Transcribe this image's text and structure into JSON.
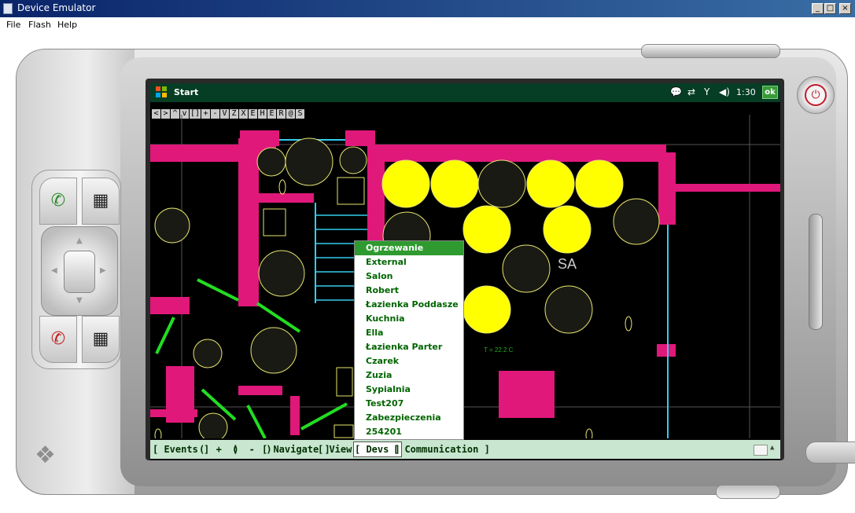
{
  "window": {
    "title": "Device Emulator",
    "buttons": {
      "minimize": "_",
      "maximize": "□",
      "close": "×"
    }
  },
  "menu": {
    "items": [
      "File",
      "Flash",
      "Help"
    ]
  },
  "device": {
    "taskbar": {
      "start_label": "Start",
      "time": "1:30",
      "ok_label": "ok",
      "status_icons": [
        "notification-bubble-icon",
        "connectivity-arrows-icon",
        "signal-off-icon",
        "speaker-icon"
      ]
    },
    "toolbar": {
      "buttons": [
        "<",
        ">",
        "^",
        "v",
        "[]",
        "+",
        "-",
        "V",
        "Z",
        "X",
        "E",
        "H",
        "E",
        "R",
        "@",
        "S"
      ]
    },
    "map": {
      "room_label": "SA",
      "temperature_label": "T = 22.2 C"
    },
    "dropdown": {
      "items": [
        "Ogrzewanie",
        "External",
        "Salon",
        "Robert",
        "Łazienka Poddasze",
        "Kuchnia",
        "Ella",
        "Łazienka Parter",
        "Czarek",
        "Zuzia",
        "Sypialnia",
        "Test207",
        "Zabezpieczenia",
        "254201"
      ],
      "selected": "Ogrzewanie"
    },
    "bottom_menu": {
      "events": "[ Events ]",
      "paren_open_plus": "(  +  )",
      "paren_open_minus": "(  -  )",
      "navigate": "[ Navigate ]",
      "view": "[ View ]",
      "devs": "[ Devs ]",
      "communication": "[ Communication ]"
    }
  },
  "colors": {
    "wall": "#e0187a",
    "lamp_on": "#ffff00",
    "lamp_off_fill": "#1a1a14",
    "lamp_outline": "#e6e66e",
    "pipe": "#33ccee",
    "line_green": "#22dd22",
    "taskbar": "#063d25",
    "menu_green": "#006400",
    "selected_bg": "#2f9a2f"
  }
}
